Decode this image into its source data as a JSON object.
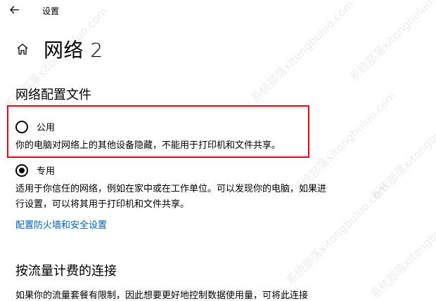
{
  "topbar": {
    "back_icon": "back-arrow-icon",
    "title": "设置"
  },
  "header": {
    "home_icon": "home-icon",
    "title": "网络 2"
  },
  "profile": {
    "heading": "网络配置文件",
    "options": [
      {
        "label": "公用",
        "selected": false,
        "description": "你的电脑对网络上的其他设备隐藏，不能用于打印机和文件共享。"
      },
      {
        "label": "专用",
        "selected": true,
        "description": "适用于你信任的网络，例如在家中或在工作单位。可以发现你的电脑，如果进行设置，可以将其用于打印机和文件共享。"
      }
    ],
    "firewall_link": "配置防火墙和安全设置"
  },
  "metered": {
    "heading": "按流量计费的连接",
    "description": "如果你的流量套餐有限制，因此想要更好地控制数据使用量，可将此连接"
  },
  "watermark_text": "系统部落xitongbuluo.com",
  "colors": {
    "link": "#0063b1",
    "highlight": "#e60012"
  }
}
